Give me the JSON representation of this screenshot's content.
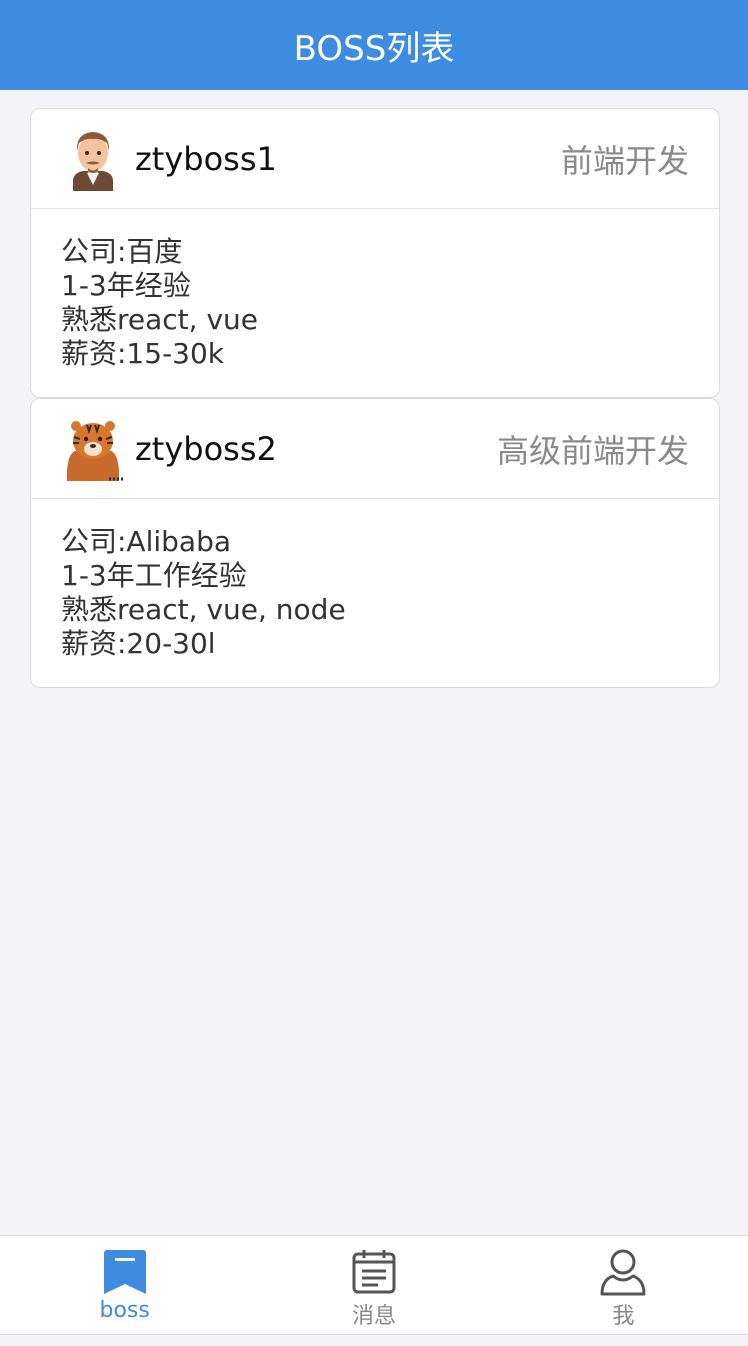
{
  "navbar": {
    "title": "BOSS列表"
  },
  "colors": {
    "accent": "#3d8ce2",
    "background": "#f3f3f8",
    "muted": "#8a8a8a"
  },
  "cards": [
    {
      "name": "ztyboss1",
      "title": "前端开发",
      "avatar": "man-avatar-icon",
      "company": "公司:百度",
      "experience": "1-3年经验",
      "skills": "熟悉react, vue",
      "salary": "薪资:15-30k"
    },
    {
      "name": "ztyboss2",
      "title": "高级前端开发",
      "avatar": "tiger-avatar-icon",
      "company": "公司:Alibaba",
      "experience": "1-3年工作经验",
      "skills": "熟悉react, vue, node",
      "salary": "薪资:20-30l"
    }
  ],
  "tabbar": {
    "tabs": [
      {
        "label": "boss",
        "icon": "bookmark-icon",
        "active": true
      },
      {
        "label": "消息",
        "icon": "calendar-icon",
        "active": false
      },
      {
        "label": "我",
        "icon": "user-icon",
        "active": false
      }
    ]
  }
}
